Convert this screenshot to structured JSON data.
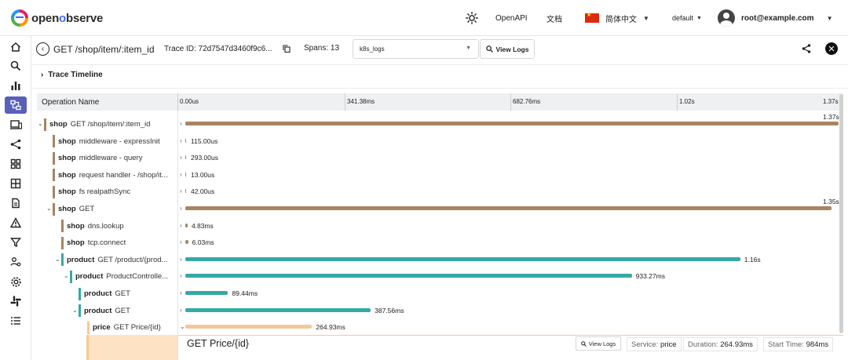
{
  "app": {
    "logo_prefix": "open",
    "logo_o": "o",
    "logo_suffix": "bserve"
  },
  "header": {
    "openapi": "OpenAPI",
    "docs": "文档",
    "language": "简体中文",
    "org": "default",
    "user": "root@example.com"
  },
  "nav": [
    "home-icon",
    "search-icon",
    "bar-chart-icon",
    "traces-icon",
    "devices-icon",
    "share-nodes-icon",
    "dashboard-icon",
    "grid-icon",
    "document-icon",
    "alert-icon",
    "filter-icon",
    "user-settings-icon",
    "settings-icon",
    "slack-icon",
    "list-icon"
  ],
  "trace": {
    "title": "GET /shop/item/:item_id",
    "trace_id": "Trace ID: 72d7547d3460f9c6...",
    "spans": "Spans: 13",
    "stream": "k8s_logs",
    "view_logs": "View Logs",
    "timeline_label": "Trace Timeline"
  },
  "table": {
    "col_name": "Operation Name",
    "ticks": [
      "0.00us",
      "341.38ms",
      "682.76ms",
      "1.02s",
      "1.37s"
    ],
    "total_ms": 1365.5
  },
  "colors": {
    "shop": "#a88462",
    "product": "#36a9a6",
    "price": "#f5c79a",
    "active_nav": "#5960b9"
  },
  "rows": [
    {
      "indent": 0,
      "expandable": true,
      "service": "shop",
      "op": "GET /shop/item/:item_id",
      "start_ms": 0,
      "dur_ms": 1370,
      "dur_label": "1.37s"
    },
    {
      "indent": 1,
      "expandable": false,
      "service": "shop",
      "op": "middleware - expressInit",
      "start_ms": 0,
      "dur_ms": 0.115,
      "dur_label": "115.00us"
    },
    {
      "indent": 1,
      "expandable": false,
      "service": "shop",
      "op": "middleware - query",
      "start_ms": 0,
      "dur_ms": 0.293,
      "dur_label": "293.00us"
    },
    {
      "indent": 1,
      "expandable": false,
      "service": "shop",
      "op": "request handler - /shop/it...",
      "start_ms": 0,
      "dur_ms": 0.013,
      "dur_label": "13.00us"
    },
    {
      "indent": 1,
      "expandable": false,
      "service": "shop",
      "op": "fs realpathSync",
      "start_ms": 0,
      "dur_ms": 0.042,
      "dur_label": "42.00us"
    },
    {
      "indent": 1,
      "expandable": true,
      "service": "shop",
      "op": "GET",
      "start_ms": 0,
      "dur_ms": 1350,
      "dur_label": "1.35s"
    },
    {
      "indent": 2,
      "expandable": false,
      "service": "shop",
      "op": "dns.lookup",
      "start_ms": 0,
      "dur_ms": 4.83,
      "dur_label": "4.83ms"
    },
    {
      "indent": 2,
      "expandable": false,
      "service": "shop",
      "op": "tcp.connect",
      "start_ms": 0,
      "dur_ms": 6.03,
      "dur_label": "6.03ms"
    },
    {
      "indent": 2,
      "expandable": true,
      "service": "product",
      "op": "GET /product/{prod...",
      "start_ms": 0,
      "dur_ms": 1160,
      "dur_label": "1.16s"
    },
    {
      "indent": 3,
      "expandable": true,
      "service": "product",
      "op": "ProductControlle...",
      "start_ms": 0,
      "dur_ms": 933.27,
      "dur_label": "933.27ms"
    },
    {
      "indent": 4,
      "expandable": false,
      "service": "product",
      "op": "GET",
      "start_ms": 0,
      "dur_ms": 89.44,
      "dur_label": "89.44ms"
    },
    {
      "indent": 4,
      "expandable": true,
      "service": "product",
      "op": "GET",
      "start_ms": 0,
      "dur_ms": 387.56,
      "dur_label": "387.56ms"
    },
    {
      "indent": 5,
      "expandable": false,
      "service": "price",
      "op": "GET Price/{id}",
      "start_ms": 0,
      "dur_ms": 264.93,
      "dur_label": "264.93ms",
      "selected": true
    }
  ],
  "detail": {
    "title": "GET Price/{id}",
    "view_logs": "View Logs",
    "service_label": "Service:",
    "service": "price",
    "duration_label": "Duration:",
    "duration": "264.93ms",
    "start_label": "Start Time:",
    "start": "984ms"
  }
}
